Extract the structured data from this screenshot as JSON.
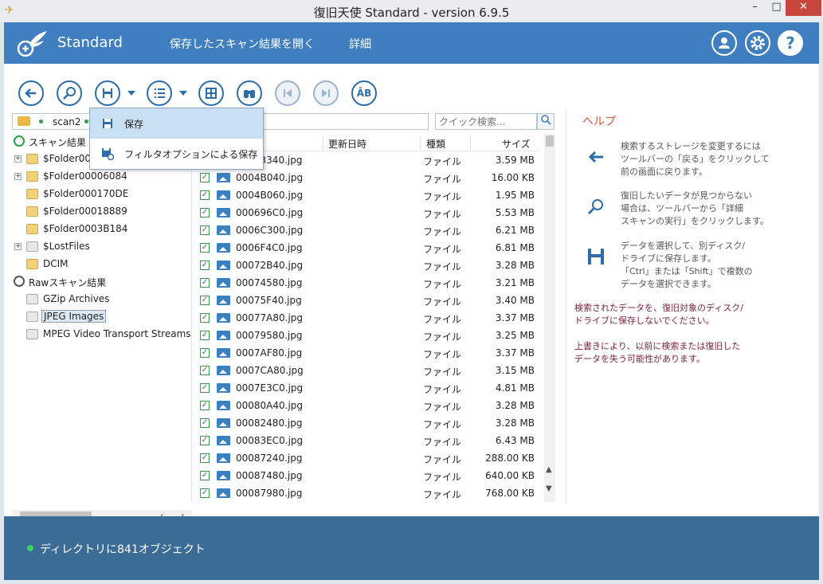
{
  "window": {
    "title": "復旧天使 Standard - version 6.9.5",
    "min": "–",
    "max": "□",
    "close": "✕"
  },
  "header": {
    "brand": "Standard",
    "nav": {
      "save_results": "保存したスキャン結果を開く",
      "details": "詳細"
    },
    "help": "?"
  },
  "toolbar": {
    "buttons": [
      "back-icon",
      "deep-scan-icon",
      "save-icon",
      "checklist-icon",
      "grid-icon",
      "binoculars-icon",
      "prev-icon",
      "next-icon",
      "text-case-icon"
    ],
    "case_label": "ĀB"
  },
  "menu": {
    "items": [
      {
        "label": "保存",
        "icon": "save-icon"
      },
      {
        "label": "フィルタオプションによる保存",
        "icon": "filter-save-icon"
      }
    ]
  },
  "path": {
    "current": "scan2"
  },
  "search": {
    "placeholder": "クイック検索..."
  },
  "tree": {
    "items": [
      {
        "label": "スキャン結果"
      },
      {
        "label": "$Folder00000000"
      },
      {
        "label": "$Folder00006084"
      },
      {
        "label": "$Folder000170DE"
      },
      {
        "label": "$Folder00018889"
      },
      {
        "label": "$Folder0003B184"
      },
      {
        "label": "$LostFiles"
      },
      {
        "label": "DCIM"
      },
      {
        "label": "Rawスキャン結果"
      },
      {
        "label": "GZip Archives"
      },
      {
        "label": "JPEG Images"
      },
      {
        "label": "MPEG Video Transport Streams"
      }
    ]
  },
  "list": {
    "columns": {
      "name": "名前",
      "modified": "更新日時",
      "type": "種類",
      "size": "サイズ"
    },
    "rows": [
      {
        "name": "00043340.jpg",
        "type": "ファイル",
        "size": "3.59 MB"
      },
      {
        "name": "0004B040.jpg",
        "type": "ファイル",
        "size": "16.00 KB"
      },
      {
        "name": "0004B060.jpg",
        "type": "ファイル",
        "size": "1.95 MB"
      },
      {
        "name": "000696C0.jpg",
        "type": "ファイル",
        "size": "5.53 MB"
      },
      {
        "name": "0006C300.jpg",
        "type": "ファイル",
        "size": "6.21 MB"
      },
      {
        "name": "0006F4C0.jpg",
        "type": "ファイル",
        "size": "6.81 MB"
      },
      {
        "name": "00072B40.jpg",
        "type": "ファイル",
        "size": "3.28 MB"
      },
      {
        "name": "00074580.jpg",
        "type": "ファイル",
        "size": "3.21 MB"
      },
      {
        "name": "00075F40.jpg",
        "type": "ファイル",
        "size": "3.40 MB"
      },
      {
        "name": "00077A80.jpg",
        "type": "ファイル",
        "size": "3.37 MB"
      },
      {
        "name": "00079580.jpg",
        "type": "ファイル",
        "size": "3.25 MB"
      },
      {
        "name": "0007AF80.jpg",
        "type": "ファイル",
        "size": "3.37 MB"
      },
      {
        "name": "0007CA80.jpg",
        "type": "ファイル",
        "size": "3.15 MB"
      },
      {
        "name": "0007E3C0.jpg",
        "type": "ファイル",
        "size": "4.81 MB"
      },
      {
        "name": "00080A40.jpg",
        "type": "ファイル",
        "size": "3.28 MB"
      },
      {
        "name": "00082480.jpg",
        "type": "ファイル",
        "size": "3.28 MB"
      },
      {
        "name": "00083EC0.jpg",
        "type": "ファイル",
        "size": "6.43 MB"
      },
      {
        "name": "00087240.jpg",
        "type": "ファイル",
        "size": "288.00 KB"
      },
      {
        "name": "00087480.jpg",
        "type": "ファイル",
        "size": "640.00 KB"
      },
      {
        "name": "00087980.jpg",
        "type": "ファイル",
        "size": "768.00 KB"
      }
    ]
  },
  "help": {
    "title": "ヘルプ",
    "items": [
      {
        "icon": "back-arrow-icon",
        "text": "検索するストレージを変更するには\nツールバーの「戻る」をクリックして\n前の画面に戻ります。"
      },
      {
        "icon": "deep-scan-icon",
        "text": "復旧したいデータが見つからない\n場合は、ツールバーから「詳細\nスキャンの実行」をクリックします。"
      },
      {
        "icon": "save-icon",
        "text": "データを選択して、別ディスク/\nドライブに保存します。\n「Ctrl」または「Shift」で複数の\nデータを選択できます。"
      }
    ],
    "notes": [
      "検索されたデータを、復旧対象のディスク/\nドライブに保存しないでください。",
      "上書きにより、以前に検索または復旧した\nデータを失う可能性があります。"
    ]
  },
  "status": {
    "text": "ディレクトリに841オブジェクト"
  },
  "colors": {
    "header": "#3f7fbf",
    "status": "#3a6c96",
    "accent": "#2f6da8",
    "help_title": "#d6503c"
  }
}
